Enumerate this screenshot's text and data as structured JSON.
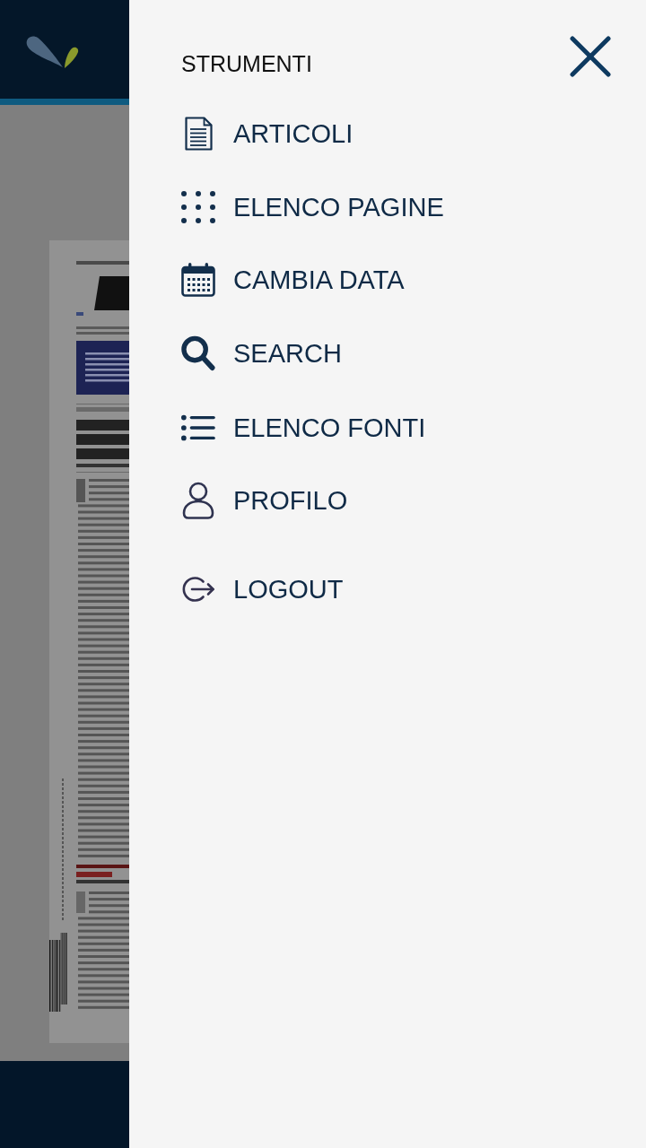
{
  "drawer": {
    "title": "STRUMENTI",
    "menu_items": [
      {
        "label": "ARTICOLI"
      },
      {
        "label": "ELENCO PAGINE"
      },
      {
        "label": "CAMBIA DATA"
      },
      {
        "label": "SEARCH"
      },
      {
        "label": "ELENCO FONTI"
      },
      {
        "label": "PROFILO"
      }
    ],
    "footer_items": [
      {
        "label": "LOGOUT"
      }
    ]
  }
}
